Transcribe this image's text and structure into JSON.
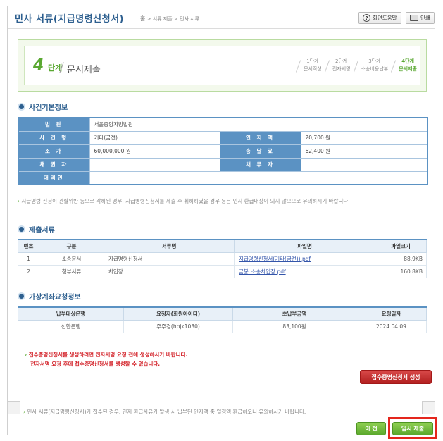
{
  "header": {
    "title": "민사 서류(지급명령신청서)",
    "breadcrumb_home": "홈",
    "breadcrumb": "> 서류 제출 > 민사 서류",
    "help_label": "화면도움말",
    "print_label": "인쇄",
    "help_icon": "question-circle-icon",
    "print_icon": "printer-icon"
  },
  "steps": {
    "current_num": "4",
    "current_label": "단계",
    "current_name": "문서제출",
    "items": [
      {
        "num": "1단계",
        "name": "문서작성"
      },
      {
        "num": "2단계",
        "name": "전자서명"
      },
      {
        "num": "3단계",
        "name": "소송비용납부"
      },
      {
        "num": "4단계",
        "name": "문서제출"
      }
    ]
  },
  "case_info": {
    "section_title": "사건기본정보",
    "court_label": "법 원",
    "court_value": "서울중앙지방법원",
    "case_name_label": "사 건 명",
    "case_name_value": "기타(금전)",
    "stamp_label": "인 지 액",
    "stamp_value": "20,700 원",
    "claim_label": "소 가",
    "claim_value": "60,000,000 원",
    "service_label": "송 달 료",
    "service_value": "62,400 원",
    "creditor_label": "채 권 자",
    "creditor_value": "",
    "debtor_label": "채 무 자",
    "debtor_value": "",
    "agent_label": "대리인",
    "agent_value": ""
  },
  "notice1": "지급명령 신청이 관할위반 등으로 각하된 경우, 지급명령신청서를 제출 후 취하하였을 경우 등은 인지 환급대상이 되지 않으므로 유의하시기 바랍니다.",
  "documents": {
    "section_title": "제출서류",
    "headers": [
      "번호",
      "구분",
      "서류명",
      "파일명",
      "파일크기"
    ],
    "rows": [
      {
        "no": "1",
        "type": "소송문서",
        "name": "지급명령신청서",
        "file": "지급명령신청서(기타(금전)).pdf",
        "size": "88.9KB"
      },
      {
        "no": "2",
        "type": "첨부서류",
        "name": "차입장",
        "file": "금봉_소송차입장.pdf",
        "size": "160.8KB"
      }
    ]
  },
  "virtual_account": {
    "section_title": "가상계좌요청정보",
    "headers": [
      "납부대상은행",
      "요청자(회원아이디)",
      "초납부금액",
      "요청일자"
    ],
    "rows": [
      {
        "bank": "신한은행",
        "requester": "주주경(hbjk1030)",
        "amount": "83,100원",
        "date": "2024.04.09"
      }
    ]
  },
  "warning": {
    "line1": "접수증명신청서를 생성하려면 전자서명 요청 전에 생성하시기 바랍니다.",
    "line2": "전자서명 요청 후에 접수증명신청서를 생성할 수 없습니다."
  },
  "receipt_button": "접수증명신청서 생성",
  "footer_note": "민사 서류(지급명령신청서)가 접수된 경우, 인지 환급사유가 발생 시 납부된 인지액 중 일정액 환급하오니 유의하시기 바랍니다.",
  "buttons": {
    "prev": "이 전",
    "save": "임시 제출"
  },
  "colors": {
    "brand_blue": "#2d5f8f",
    "table_blue": "#5b92c3",
    "step_green": "#5aa832",
    "warning_red": "#d3232a"
  }
}
